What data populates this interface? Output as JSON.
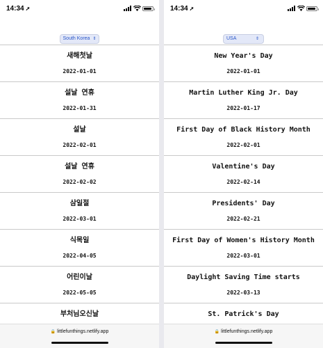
{
  "left_phone": {
    "status": {
      "time": "14:34"
    },
    "country": "South Korea",
    "holidays": [
      {
        "name": "새해첫날",
        "date": "2022-01-01"
      },
      {
        "name": "설날 연휴",
        "date": "2022-01-31"
      },
      {
        "name": "설날",
        "date": "2022-02-01"
      },
      {
        "name": "설날 연휴",
        "date": "2022-02-02"
      },
      {
        "name": "삼일절",
        "date": "2022-03-01"
      },
      {
        "name": "식목일",
        "date": "2022-04-05"
      },
      {
        "name": "어린이날",
        "date": "2022-05-05"
      },
      {
        "name": "부처님오신날",
        "date": ""
      }
    ],
    "url": "littlefunthings.netlify.app"
  },
  "right_phone": {
    "status": {
      "time": "14:34"
    },
    "country": "USA",
    "holidays": [
      {
        "name": "New Year's Day",
        "date": "2022-01-01"
      },
      {
        "name": "Martin Luther King Jr. Day",
        "date": "2022-01-17"
      },
      {
        "name": "First Day of Black History Month",
        "date": "2022-02-01"
      },
      {
        "name": "Valentine's Day",
        "date": "2022-02-14"
      },
      {
        "name": "Presidents' Day",
        "date": "2022-02-21"
      },
      {
        "name": "First Day of Women's History Month",
        "date": "2022-03-01"
      },
      {
        "name": "Daylight Saving Time starts",
        "date": "2022-03-13"
      },
      {
        "name": "St. Patrick's Day",
        "date": ""
      }
    ],
    "url": "littlefunthings.netlify.app"
  },
  "colors": {
    "select_bg": "#e3e8f8",
    "select_text": "#2a57c9",
    "divider": "#c9c9c9"
  },
  "icons": [
    "location-arrow-icon",
    "signal-icon",
    "wifi-icon",
    "battery-icon",
    "chevron-updown-icon",
    "lock-icon"
  ]
}
